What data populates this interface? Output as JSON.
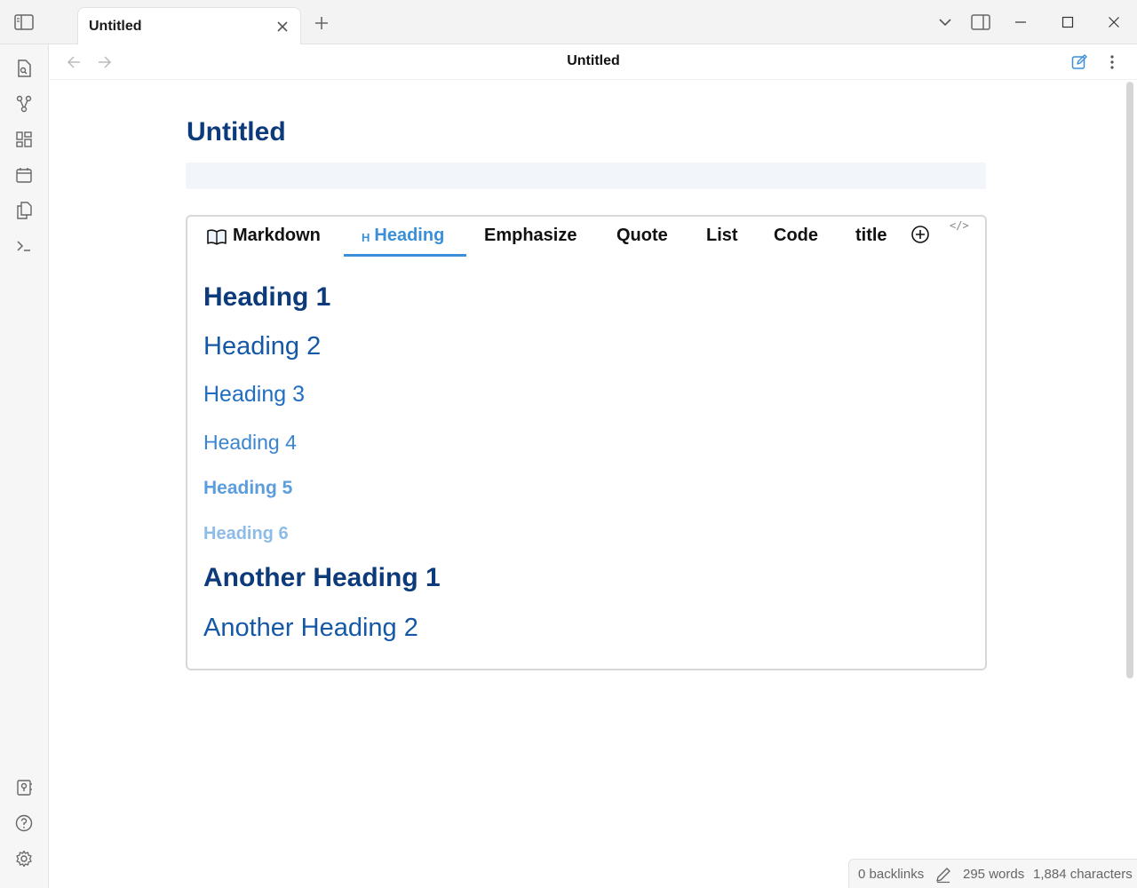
{
  "window": {
    "tab_title": "Untitled",
    "view_title": "Untitled"
  },
  "document": {
    "title": "Untitled",
    "tabs": [
      {
        "label": "Markdown",
        "icon": "book-open-icon"
      },
      {
        "label": "Heading",
        "icon": "heading-icon",
        "icon_text": "H",
        "active": true
      },
      {
        "label": "Emphasize"
      },
      {
        "label": "Quote"
      },
      {
        "label": "List"
      },
      {
        "label": "Code"
      },
      {
        "label": "title"
      }
    ],
    "code_toggle": "</>",
    "headings": [
      {
        "level": 1,
        "text": "Heading 1"
      },
      {
        "level": 2,
        "text": "Heading 2"
      },
      {
        "level": 3,
        "text": "Heading 3"
      },
      {
        "level": 4,
        "text": "Heading 4"
      },
      {
        "level": 5,
        "text": "Heading 5"
      },
      {
        "level": 6,
        "text": "Heading 6"
      },
      {
        "level": 1,
        "text": "Another Heading 1"
      },
      {
        "level": 2,
        "text": "Another Heading 2"
      }
    ]
  },
  "statusbar": {
    "backlinks": "0 backlinks",
    "words": "295 words",
    "characters": "1,884 characters"
  },
  "colors": {
    "accent": "#3a8fd8",
    "heading1": "#0d3a7a",
    "heading2": "#1458a6"
  }
}
